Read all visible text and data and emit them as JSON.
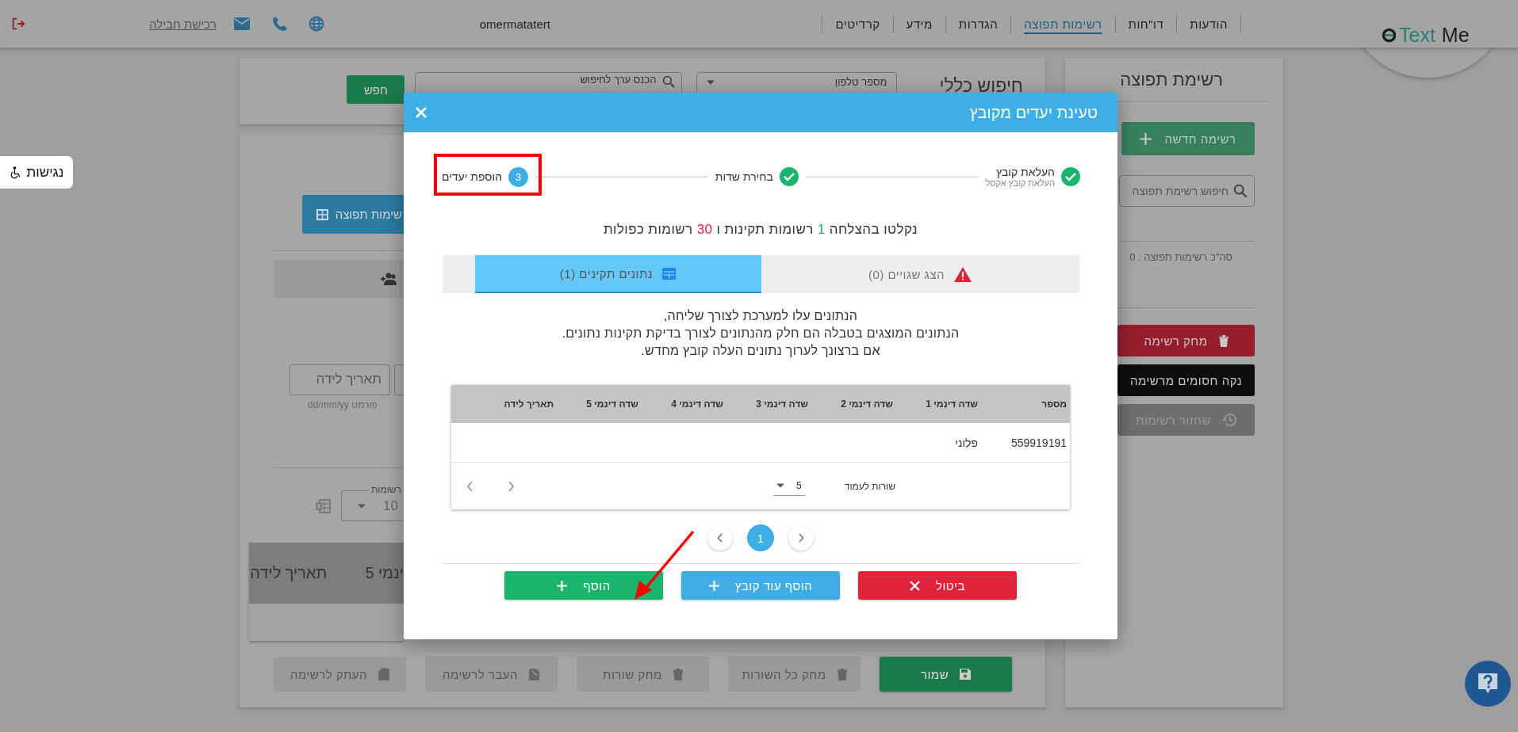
{
  "header": {
    "nav": [
      {
        "label": "הודעות",
        "selected": false
      },
      {
        "label": "דו\"חות",
        "selected": false
      },
      {
        "label": "רשימות תפוצה",
        "selected": true
      },
      {
        "label": "הגדרות",
        "selected": false
      },
      {
        "label": "מידע",
        "selected": false
      },
      {
        "label": "קרדיטים",
        "selected": false
      }
    ],
    "user": "omermatatert",
    "purchase_link": "רכישת חבילה",
    "logo": {
      "word_1": "Text",
      "word_2": "Me"
    }
  },
  "accessibility": {
    "label": "נגישות"
  },
  "sidebar": {
    "title": "רשימת תפוצה",
    "new_button": "רשימה חדשה",
    "search_placeholder": "חיפוש רשימת תפוצה",
    "total": "סה\"כ רשימות תפוצה : 0",
    "buttons": [
      {
        "label": "מחק רשימה",
        "kind": "delete"
      },
      {
        "label": "נקה חסומים מרשימה",
        "kind": "clear"
      },
      {
        "label": "שחזור רשימות",
        "kind": "restore"
      }
    ]
  },
  "search_card": {
    "title": "חיפוש כללי",
    "field_select": "מספר טלפון",
    "search_placeholder": "הכנס ערך לחיפוש",
    "button": "חפש"
  },
  "main_card": {
    "list_button": "שימות תפוצה",
    "birth_field": {
      "placeholder": "תאריך לידה",
      "hint": "פורמט dd/mm/yy"
    },
    "records": {
      "label": "רשומות",
      "value": "10"
    },
    "table_columns": [
      "ינמי 5",
      "תאריך לידה"
    ],
    "actions": [
      {
        "label": "שמור",
        "kind": "save",
        "disabled": false
      },
      {
        "label": "מחק כל השורות",
        "kind": "delete",
        "disabled": true
      },
      {
        "label": "מחק שורות",
        "kind": "delete",
        "disabled": true
      },
      {
        "label": "העבר לרשימה",
        "kind": "move",
        "disabled": true
      },
      {
        "label": "העתק לרשימה",
        "kind": "copy",
        "disabled": true
      }
    ]
  },
  "modal": {
    "title": "טעינת יעדים מקובץ",
    "steps": [
      {
        "label": "העלאת קובץ",
        "sublabel": "העלאת קובץ אקסל",
        "done": true,
        "highlighted": false
      },
      {
        "label": "בחירת שדות",
        "done": true,
        "highlighted": false
      },
      {
        "label": "הוספת יעדים",
        "number": "3",
        "done": false,
        "highlighted": true
      }
    ],
    "summary": [
      {
        "text": "נקלטו בהצלחה "
      },
      {
        "text": "1",
        "color": "#1ab46c"
      },
      {
        "text": " רשומות תקינות ו "
      },
      {
        "text": "30",
        "color": "#e0223a"
      },
      {
        "text": " רשומות כפולות"
      }
    ],
    "tabs": [
      {
        "label": "הצג שגויים (0)",
        "kind": "errors",
        "selected": false
      },
      {
        "label": "נתונים תקינים (1)",
        "kind": "valid",
        "selected": true
      }
    ],
    "info": [
      "הנתונים עלו למערכת לצורך שליחה,",
      "הנתונים המוצגים בטבלה הם חלק מהנתונים לצורך בדיקת תקינות נתונים.",
      "אם ברצונך לערוך נתונים העלה קובץ מחדש."
    ],
    "table": {
      "columns": [
        "מספר",
        "שדה דינמי 1",
        "שדה דינמי 2",
        "שדה דינמי 3",
        "שדה דינמי 4",
        "שדה דינמי 5",
        "תאריך לידה"
      ],
      "rows": [
        {
          "cells": [
            "559919191",
            "פלוני"
          ]
        }
      ],
      "rows_per_page_label": "שורות לעמוד",
      "rows_per_page": "5"
    },
    "pages": [
      {
        "label": "1",
        "selected": true
      }
    ],
    "buttons": [
      {
        "label": "ביטול",
        "kind": "cancel",
        "pointed": false
      },
      {
        "label": "הוסף עוד קובץ",
        "kind": "add_file",
        "pointed": false
      },
      {
        "label": "הוסף",
        "kind": "add",
        "pointed": true
      }
    ]
  }
}
